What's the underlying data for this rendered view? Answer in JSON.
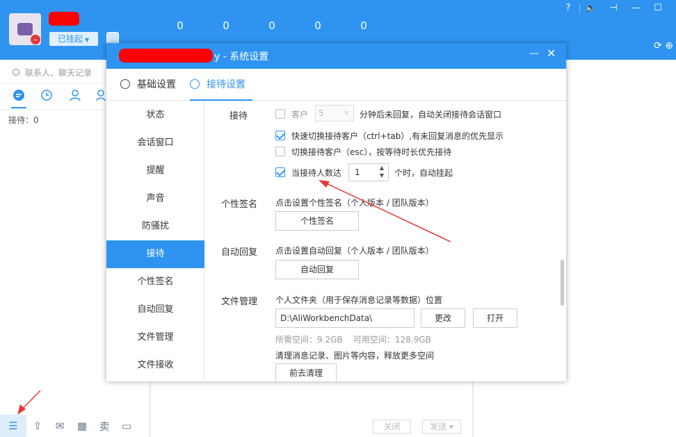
{
  "header": {
    "status_label": "已挂起",
    "stats": [
      "0",
      "0",
      "0",
      "0",
      "0"
    ],
    "win_controls": [
      "?",
      "🔈",
      "⊣",
      "—",
      "☐"
    ]
  },
  "left": {
    "search_placeholder": "联系人、聊天记录",
    "recv_count": "接待：0",
    "bottom_icons": [
      "menu-icon",
      "share-icon",
      "mail-icon",
      "store-icon",
      "sell-icon",
      "panel-icon"
    ],
    "sell_label": "卖"
  },
  "chat": {
    "close_label": "关闭",
    "send_label": "发送"
  },
  "dialog": {
    "title_suffix": "y - 系统设置",
    "tabs": [
      "基础设置",
      "接待设置"
    ],
    "nav": [
      "状态",
      "会话窗口",
      "提醒",
      "声音",
      "防骚扰",
      "接待",
      "个性签名",
      "自动回复",
      "文件管理",
      "文件接收"
    ],
    "active_nav": "接待",
    "reception": {
      "label": "接待",
      "customer_label": "客户",
      "customer_minutes": "5",
      "customer_suffix": "分钟后未回复，自动关闭接待会话窗口",
      "fast_switch": "快速切换接待客户（ctrl+tab）,有未回复消息的优先显示",
      "switch_esc": "切换接待客户（esc），按等待时长优先接待",
      "limit_label": "当接待人数达",
      "limit_value": "1",
      "limit_suffix": "个时，自动挂起"
    },
    "signature": {
      "label": "个性签名",
      "desc": "点击设置个性签名（个人版本 / 团队版本）",
      "button": "个性签名"
    },
    "autoreply": {
      "label": "自动回复",
      "desc": "点击设置自动回复（个人版本 / 团队版本）",
      "button": "自动回复"
    },
    "files": {
      "label": "文件管理",
      "desc": "个人文件夹（用于保存消息记录等数据）位置",
      "path": "D:\\AliWorkbenchData\\",
      "change_btn": "更改",
      "open_btn": "打开",
      "space": "所需空间：9.2GB    可用空间：128.9GB",
      "clean_desc": "清理消息记录、图片等内容，释放更多空间",
      "clean_btn": "前去清理"
    }
  },
  "colors": {
    "accent": "#2f94f0",
    "annotation": "#e53935"
  }
}
